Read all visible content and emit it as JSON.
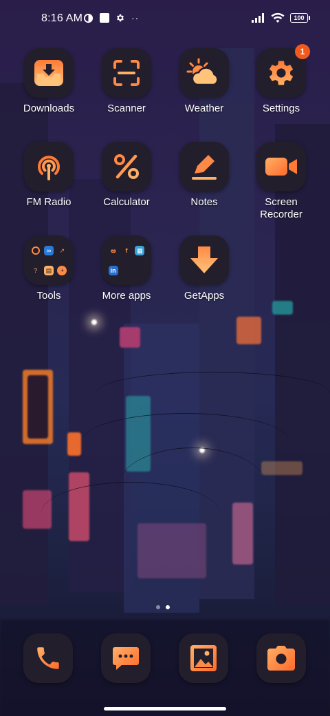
{
  "status_bar": {
    "time": "8:16 AM",
    "battery": "100",
    "left_icons": [
      "vpn-icon",
      "square-notification-icon",
      "gear-icon",
      "more-dots-icon"
    ],
    "right_icons": [
      "signal-icon",
      "wifi-icon",
      "battery-icon"
    ]
  },
  "apps": [
    {
      "label": "Downloads",
      "icon": "download-tray-icon"
    },
    {
      "label": "Scanner",
      "icon": "scanner-icon"
    },
    {
      "label": "Weather",
      "icon": "sun-cloud-icon"
    },
    {
      "label": "Settings",
      "icon": "gear-icon",
      "badge": "1"
    },
    {
      "label": "FM Radio",
      "icon": "radio-broadcast-icon"
    },
    {
      "label": "Calculator",
      "icon": "percent-icon"
    },
    {
      "label": "Notes",
      "icon": "pencil-icon"
    },
    {
      "label": "Screen Recorder",
      "icon": "video-camera-icon"
    },
    {
      "label": "Tools",
      "icon": "folder-icon"
    },
    {
      "label": "More apps",
      "icon": "folder-icon"
    },
    {
      "label": "GetApps",
      "icon": "download-arrow-icon"
    }
  ],
  "folder_mini_labels": {
    "tools": [
      "",
      "∞",
      "↗",
      "?",
      "▤",
      "+"
    ],
    "more_apps": [
      "ఆ",
      "f",
      "▦",
      "in",
      "",
      ""
    ]
  },
  "dock": [
    {
      "name": "phone",
      "icon": "phone-icon"
    },
    {
      "name": "messages",
      "icon": "message-icon"
    },
    {
      "name": "gallery",
      "icon": "image-icon"
    },
    {
      "name": "camera",
      "icon": "camera-icon"
    }
  ],
  "pages": {
    "count": 2,
    "active": 2
  },
  "colors": {
    "accent_start": "#ffb067",
    "accent_end": "#ff6a2b",
    "tile": "#231e2c",
    "badge": "#f25a1d"
  }
}
